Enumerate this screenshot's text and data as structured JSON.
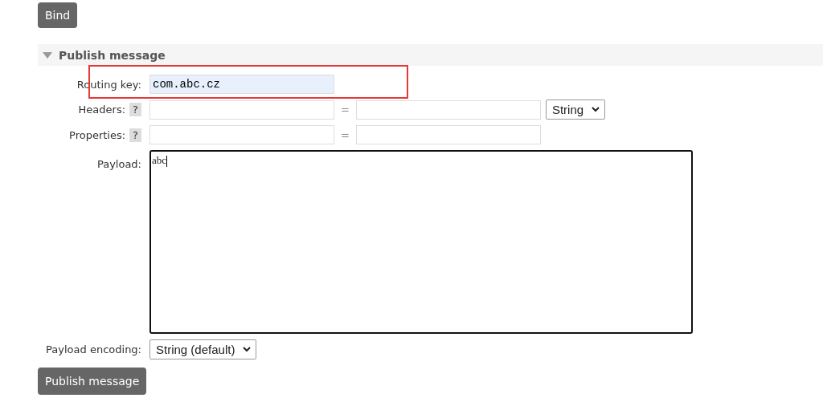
{
  "bind_button": "Bind",
  "section": {
    "title": "Publish message",
    "expanded": true
  },
  "routing_key": {
    "label": "Routing key:",
    "value": "com.abc.cz",
    "highlighted": true
  },
  "headers": {
    "label": "Headers:",
    "help": "?",
    "equals": "=",
    "type": "String"
  },
  "properties": {
    "label": "Properties:",
    "help": "?",
    "equals": "="
  },
  "payload": {
    "label": "Payload:",
    "value": "abc",
    "focused": true
  },
  "payload_encoding": {
    "label": "Payload encoding:",
    "value": "String (default)"
  },
  "publish_button": "Publish message"
}
